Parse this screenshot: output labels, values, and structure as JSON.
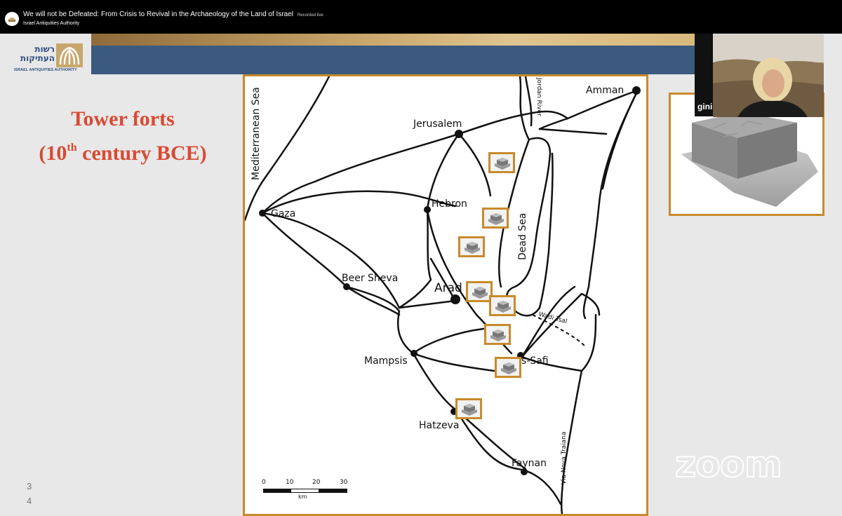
{
  "header": {
    "video_title": "We will not be Defeated: From Crisis to Revival in the Archaeology of the Land of Israel",
    "live_badge": "Recorded live",
    "channel_name": "Israel Antiquities Authority"
  },
  "slide": {
    "logo_hebrew_line1": "רשות",
    "logo_hebrew_line2": "העתיקות",
    "logo_english": "ISRAEL ANTIQUITIES AUTHORITY",
    "title_line1": "Tower forts",
    "title_line2_pre": "(10",
    "title_sup": "th",
    "title_line2_post": " century BCE)",
    "page_numbers": [
      "3",
      "4"
    ]
  },
  "map": {
    "labels": {
      "amman": "Amman",
      "jerusalem": "Jerusalem",
      "jordan_river": "Jordan River",
      "mediterranean_sea": "Mediterranean Sea",
      "gaza": "Gaza",
      "hebron": "Hebron",
      "dead_sea": "Dead Sea",
      "beer_sheva": "Beer Sheva",
      "arad": "Arad",
      "wadi_tsal": "Wadi Tsal",
      "mampsis": "Mampsis",
      "es_safi": "s-Safi",
      "hatzeva": "Hatzeva",
      "via_nova": "Via Nova Traiana",
      "faynan": "Faynan"
    },
    "scale": {
      "ticks": [
        "0",
        "10",
        "20",
        "30"
      ],
      "unit": "km"
    }
  },
  "video": {
    "participant_name": "gini"
  },
  "branding": {
    "zoom_watermark": "zoom"
  },
  "colors": {
    "accent_orange": "#c98a2c",
    "title_red": "#d94a33",
    "band_blue": "#3c5a80"
  }
}
